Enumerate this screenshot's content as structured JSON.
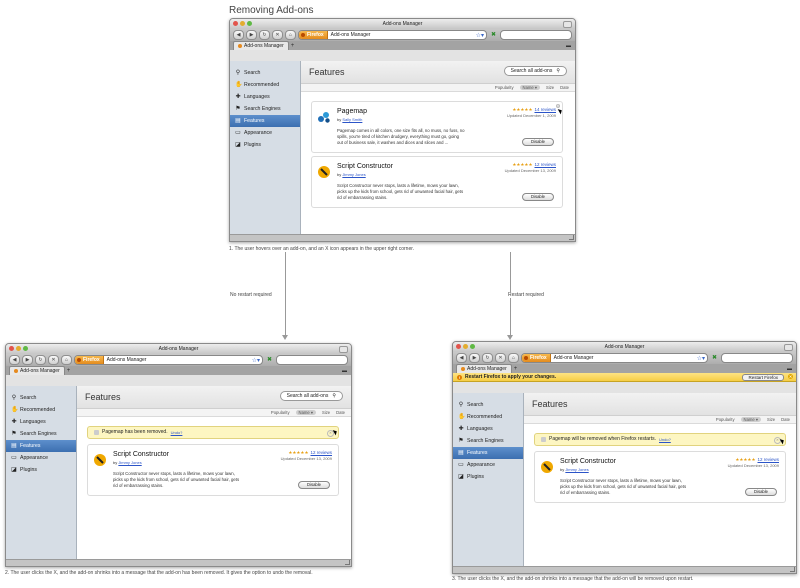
{
  "page_title": "Removing Add-ons",
  "captions": {
    "step1": "1. The user hovers over an add-on, and an X icon appears in the upper right corner.",
    "step2": "2. The user clicks the X, and the add-on shrinks into a message that the add-on has been removed.  It gives the option to undo the removal.",
    "step3": "3. The user clicks the X, and the add-on shrinks into a message that the add-on will be removed upon restart."
  },
  "branches": {
    "left": "No restart required",
    "right": "Restart required"
  },
  "window": {
    "title": "Add-ons Manager",
    "url_identity": "Firefox",
    "url_text": "Add-ons Manager",
    "tab_label": "Add-ons Manager",
    "tab_plus": "+"
  },
  "sidebar": {
    "items": [
      {
        "label": "Search",
        "icon": "search-icon",
        "glyph": "⚲"
      },
      {
        "label": "Recommended",
        "icon": "thumbs-up-icon",
        "glyph": "✋"
      },
      {
        "label": "Languages",
        "icon": "languages-icon",
        "glyph": "✚"
      },
      {
        "label": "Search Engines",
        "icon": "search-engines-icon",
        "glyph": "⚑"
      },
      {
        "label": "Features",
        "icon": "features-icon",
        "glyph": "▤"
      },
      {
        "label": "Appearance",
        "icon": "appearance-icon",
        "glyph": "▭"
      },
      {
        "label": "Plugins",
        "icon": "plugins-icon",
        "glyph": "◪"
      }
    ],
    "selected": "Features"
  },
  "main": {
    "heading": "Features",
    "search_placeholder": "Search all add-ons",
    "sort": [
      "Popularity",
      "Name ▾",
      "Size",
      "Date"
    ]
  },
  "addons": {
    "pagemap": {
      "name": "Pagemap",
      "by": "by",
      "author": "Sally Smith",
      "stars": "★★★★★",
      "reviews": "14 reviews",
      "updated": "Updated December 1, 2009",
      "desc1": "Pagemap comes in all colors, one size fits all, no muss, no fuss, no",
      "desc2": "spills, you're tired of kitchen drudgery, everything must go, going",
      "desc3": "out of business sale, it washes and dices and slices and ...",
      "button": "Disable"
    },
    "script": {
      "name": "Script Constructor",
      "by": "by",
      "author": "Jimmy Jones",
      "stars": "★★★★★",
      "reviews": "12 reviews",
      "updated": "Updated December 13, 2009",
      "desc1": "Script Constructor never stops, lasts a lifetime, mows your lawn,",
      "desc2": "picks up the kids from school, gets rid of unwanted facial hair, gets",
      "desc3": "rid of embarrassing stains.",
      "button": "Disable"
    }
  },
  "notices": {
    "removed": "Pagemap has been removed.",
    "undo": "Undo?",
    "restart": "Pagemap will be removed when Firefox restarts.",
    "restart_bar": "Restart Firefox to apply your changes.",
    "restart_button": "Restart Firefox"
  }
}
